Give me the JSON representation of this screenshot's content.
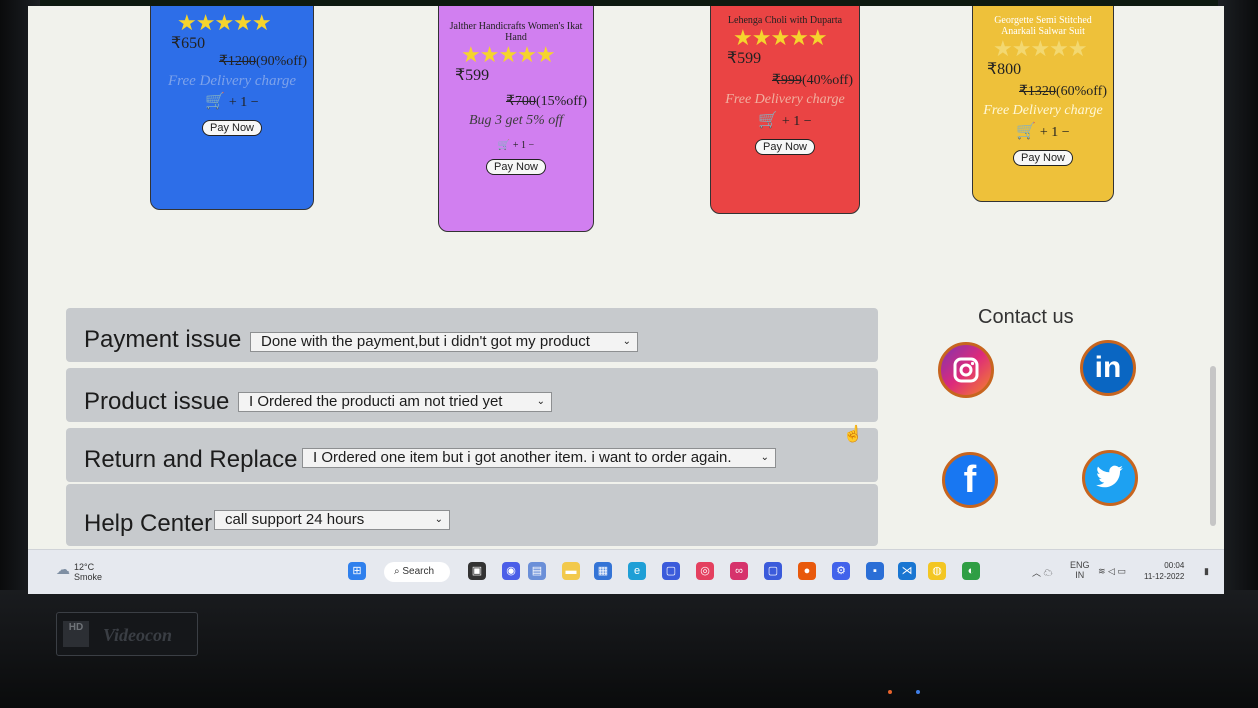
{
  "products": [
    {
      "title": "",
      "price": "₹650",
      "old_price": "₹1200",
      "discount": "(90%off)",
      "offer": "Free Delivery charge",
      "cart_controls": "+ 1 −",
      "pay_label": "Pay Now",
      "color": "#2d6ee8"
    },
    {
      "title": "Jalther Handicrafts Women's Ikat Hand",
      "price": "₹599",
      "old_price": "₹700",
      "discount": "(15%off)",
      "offer": "Bug 3 get 5% off",
      "cart_controls": "+ 1 −",
      "pay_label": "Pay Now",
      "color": "#d17ff0"
    },
    {
      "title": "Lehenga Choli with Duparta",
      "price": "₹599",
      "old_price": "₹999",
      "discount": "(40%off)",
      "offer": "Free Delivery charge",
      "cart_controls": "+ 1 −",
      "pay_label": "Pay Now",
      "color": "#ea4444"
    },
    {
      "title": "Georgette Semi Stitched Anarkali Salwar Suit",
      "price": "₹800",
      "old_price": "₹1320",
      "discount": "(60%off)",
      "offer": "Free Delivery charge",
      "cart_controls": "+ 1 −",
      "pay_label": "Pay Now",
      "color": "#eec13a"
    }
  ],
  "star_color": "#f5d42d",
  "issues": [
    {
      "label": "Payment issue",
      "selected": "Done with the payment,but i didn't got my product"
    },
    {
      "label": "Product issue",
      "selected": "I Ordered the producti am not tried yet"
    },
    {
      "label": "Return and Replace",
      "selected": "I Ordered one item but i got another item. i want to order again."
    },
    {
      "label": "Help Center",
      "selected": "call support 24 hours"
    }
  ],
  "contact": {
    "title": "Contact us",
    "icons": [
      "instagram-icon",
      "linkedin-icon",
      "facebook-icon",
      "twitter-icon"
    ]
  },
  "taskbar": {
    "weather_temp": "12°C",
    "weather_desc": "Smoke",
    "search_label": "Search",
    "lang": "ENG",
    "region": "IN",
    "time": "00:04",
    "date": "11-12-2022"
  },
  "monitor": {
    "badge": "HD",
    "brand": "Videocon"
  }
}
